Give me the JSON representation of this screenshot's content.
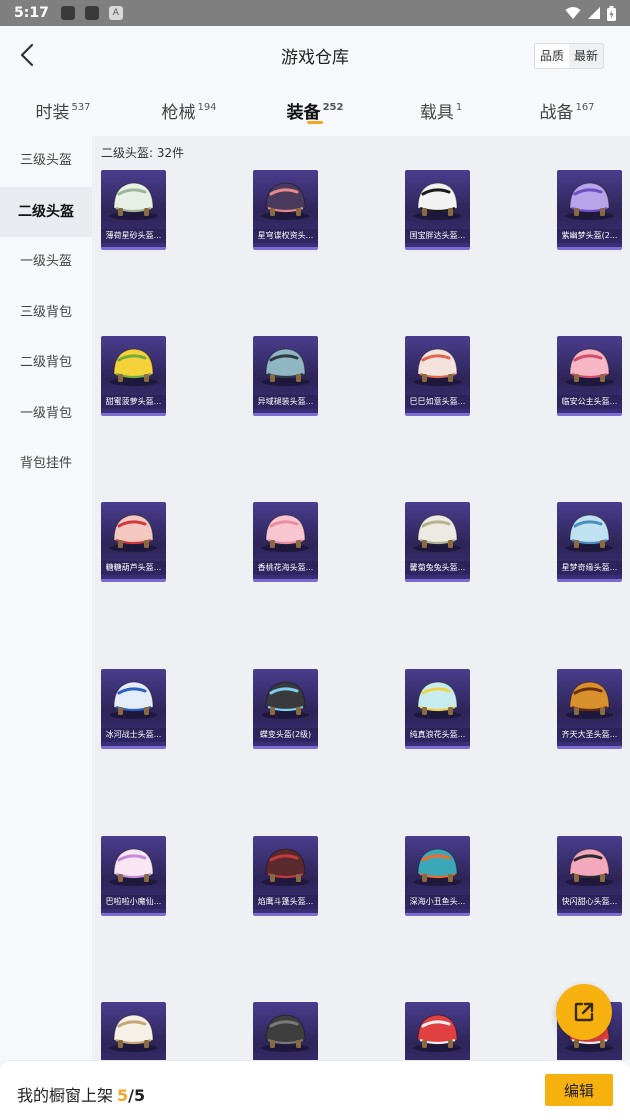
{
  "status_bar": {
    "time": "5:17",
    "icons": [
      "notification-icon",
      "notification-icon",
      "app-a-icon",
      "wifi-icon",
      "signal-icon",
      "battery-icon"
    ],
    "a_glyph": "A"
  },
  "header": {
    "title": "游戏仓库",
    "sort_options": [
      {
        "label": "品质",
        "selected": true
      },
      {
        "label": "最新",
        "selected": false
      }
    ]
  },
  "tabs": [
    {
      "label": "时装",
      "count": "537",
      "active": false
    },
    {
      "label": "枪械",
      "count": "194",
      "active": false
    },
    {
      "label": "装备",
      "count": "252",
      "active": true
    },
    {
      "label": "载具",
      "count": "1",
      "active": false
    },
    {
      "label": "战备",
      "count": "167",
      "active": false
    }
  ],
  "sidebar": {
    "items": [
      {
        "label": "三级头盔",
        "active": false
      },
      {
        "label": "二级头盔",
        "active": true
      },
      {
        "label": "一级头盔",
        "active": false
      },
      {
        "label": "三级背包",
        "active": false
      },
      {
        "label": "二级背包",
        "active": false
      },
      {
        "label": "一级背包",
        "active": false
      },
      {
        "label": "背包挂件",
        "active": false
      }
    ]
  },
  "content": {
    "count_label": "二级头盔: 32件",
    "items": [
      {
        "name": "薄荷星砂头盔...",
        "color": "#e8f0e6",
        "accent": "#9fb59a"
      },
      {
        "name": "星穹谍权资头...",
        "color": "#4a3a5e",
        "accent": "#e88a8a"
      },
      {
        "name": "国宝胖达头盔...",
        "color": "#f2f2f2",
        "accent": "#1a1a1a"
      },
      {
        "name": "紫幽梦头盔(2...",
        "color": "#b8a4e8",
        "accent": "#6f4fc4"
      },
      {
        "name": "甜蜜菠萝头盔...",
        "color": "#f5d23a",
        "accent": "#6fae3a"
      },
      {
        "name": "异域褪装头盔...",
        "color": "#8fb6c2",
        "accent": "#2b3a44"
      },
      {
        "name": "巳巳如意头盔...",
        "color": "#f4e2dc",
        "accent": "#e0674d"
      },
      {
        "name": "临安公主头盔...",
        "color": "#f7b7c4",
        "accent": "#d44d6e"
      },
      {
        "name": "糖糖葫芦头盔...",
        "color": "#f3c8c1",
        "accent": "#d13a3a"
      },
      {
        "name": "香桃花海头盔...",
        "color": "#f8c6d0",
        "accent": "#e98ea2"
      },
      {
        "name": "馨菊兔兔头盔...",
        "color": "#ecebe3",
        "accent": "#b5b18f"
      },
      {
        "name": "星梦奇缘头盔...",
        "color": "#bfe1f0",
        "accent": "#4b8fc2"
      },
      {
        "name": "冰河战士头盔...",
        "color": "#e5eef8",
        "accent": "#2a5fc4"
      },
      {
        "name": "蝶变头盔(2级)",
        "color": "#3a3a3e",
        "accent": "#7fd0f0"
      },
      {
        "name": "纯真浪花头盔...",
        "color": "#c6ecf0",
        "accent": "#f2d14a"
      },
      {
        "name": "齐天大圣头盔...",
        "color": "#d9912e",
        "accent": "#6a2d0e"
      },
      {
        "name": "巴啦啦小魔仙...",
        "color": "#f8e6f2",
        "accent": "#c48ad8"
      },
      {
        "name": "焰鹰斗篷头盔...",
        "color": "#5a2a2e",
        "accent": "#c23a3a"
      },
      {
        "name": "深海小丑鱼头...",
        "color": "#3aa8b8",
        "accent": "#f26a2a"
      },
      {
        "name": "快闪甜心头盔...",
        "color": "#f4a8bc",
        "accent": "#2b2b2b"
      },
      {
        "name": "",
        "color": "#f6f0e6",
        "accent": "#c2a678"
      },
      {
        "name": "",
        "color": "#3e3e3e",
        "accent": "#7a7a7a"
      },
      {
        "name": "",
        "color": "#e04040",
        "accent": "#f2f2f2"
      },
      {
        "name": "",
        "color": "#e84040",
        "accent": "#ffffff"
      }
    ]
  },
  "bottom_bar": {
    "shelf_label": "我的橱窗上架",
    "shelf_current": "5",
    "shelf_separator": "/",
    "shelf_total": "5",
    "edit_label": "编辑"
  },
  "colors": {
    "accent": "#f7b10f",
    "card_bg": "#2e2558",
    "card_border": "#7c6bd0"
  }
}
